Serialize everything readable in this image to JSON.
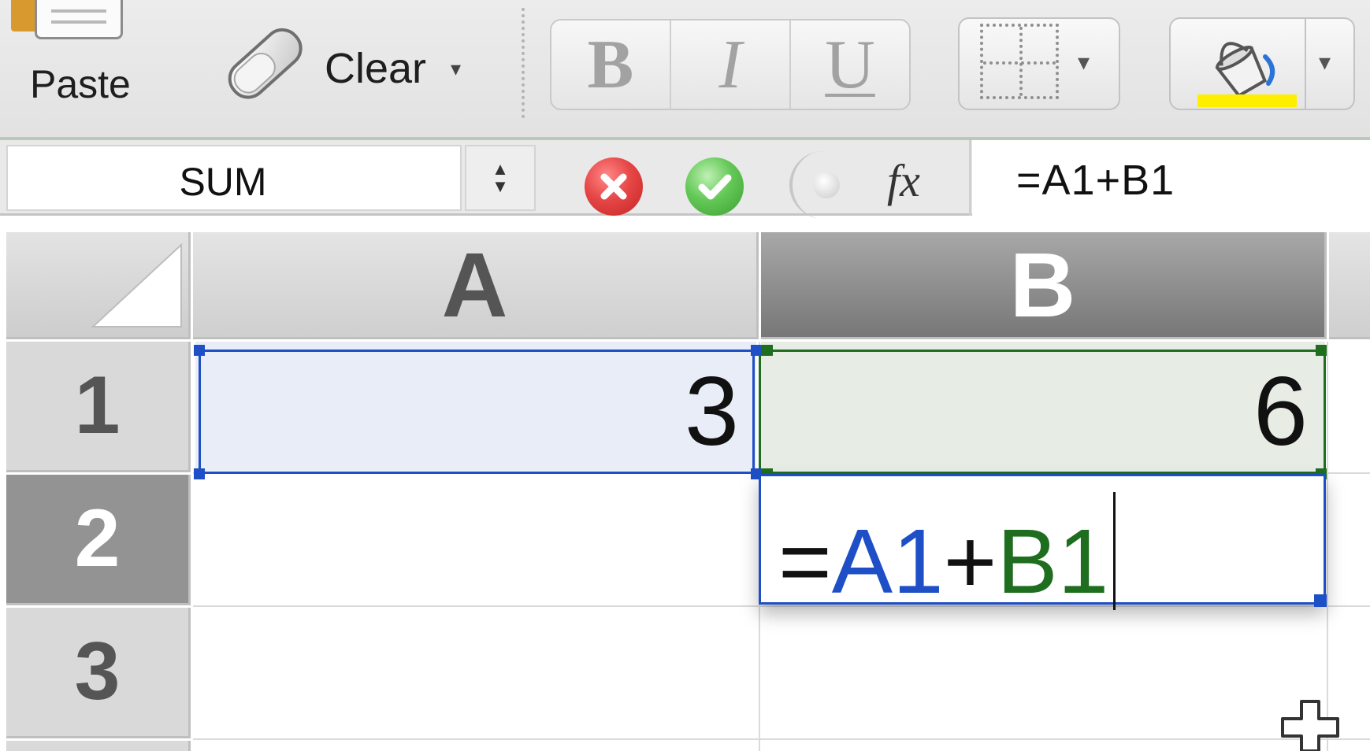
{
  "ribbon": {
    "paste_label": "Paste",
    "clear_label": "Clear",
    "clear_caret": "▾",
    "bold_label": "B",
    "italic_label": "I",
    "underline_label": "U",
    "borders_caret": "▾",
    "fill_caret": "▾",
    "fill_color": "#ffee00"
  },
  "formula_bar": {
    "name_box": "SUM",
    "stepper_up": "▲",
    "stepper_down": "▼",
    "fx_label": "fx",
    "formula": "=A1+B1"
  },
  "sheet": {
    "columns": [
      "A",
      "B"
    ],
    "rows": [
      "1",
      "2",
      "3"
    ],
    "cells": {
      "A1": "3",
      "B1": "6"
    },
    "editing_cell": {
      "ref": "B2",
      "prefix": "=",
      "ref1": "A1",
      "op": "+",
      "ref2": "B1"
    },
    "colors": {
      "ref1": "#1f4fc6",
      "ref2": "#1f6e1f"
    }
  }
}
